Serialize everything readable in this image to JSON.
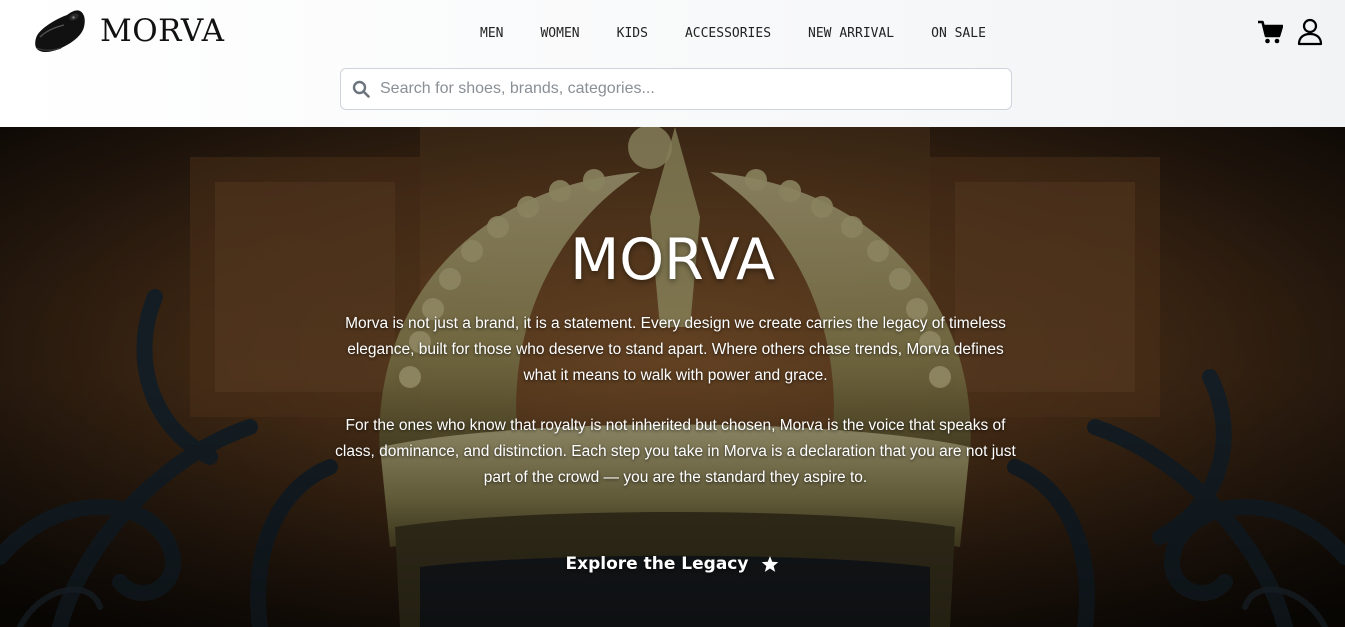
{
  "brand": {
    "name": "MORVA",
    "logo_icon": "loafer-shoe-icon"
  },
  "nav": {
    "items": [
      {
        "label": "MEN"
      },
      {
        "label": "WOMEN"
      },
      {
        "label": "KIDS"
      },
      {
        "label": "ACCESSORIES"
      },
      {
        "label": "NEW ARRIVAL"
      },
      {
        "label": "ON SALE"
      }
    ]
  },
  "header_icons": {
    "cart": "cart-icon",
    "account": "user-icon"
  },
  "search": {
    "placeholder": "Search for shoes, brands, categories...",
    "value": "",
    "icon": "search-icon"
  },
  "hero": {
    "title": "MORVA",
    "paragraphs": [
      "Morva is not just a brand, it is a statement. Every design we create carries the legacy of timeless elegance, built for those who deserve to stand apart. Where others chase trends, Morva defines what it means to walk with power and grace.",
      "For the ones who know that royalty is not inherited but chosen, Morva is the voice that speaks of class, dominance, and distinction. Each step you take in Morva is a declaration that you are not just part of the crowd — you are the standard they aspire to."
    ],
    "cta_label": "Explore the Legacy",
    "cta_icon": "star-icon",
    "background_image": "crown-on-iron-gate"
  },
  "colors": {
    "header_bg": "#f8f9fa",
    "text_dark": "#111111",
    "hero_text": "#ffffff"
  }
}
